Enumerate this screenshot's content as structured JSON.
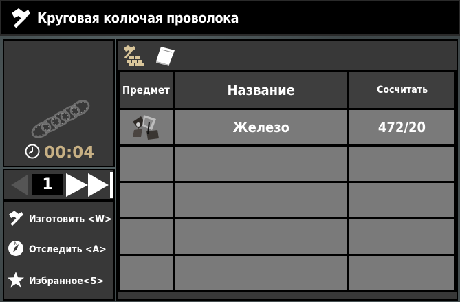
{
  "window": {
    "title": "Круговая колючая проволока",
    "title_icon": "hammer-icon"
  },
  "preview": {
    "item_icon": "barbed-wire-coil-icon",
    "craft_time": "00:04",
    "time_icon": "clock-icon"
  },
  "quantity": {
    "value": "1"
  },
  "actions": [
    {
      "label": "Изготовить <W>",
      "icon": "hammer-icon"
    },
    {
      "label": "Отследить <A>",
      "icon": "compass-icon"
    },
    {
      "label": "Избранное<S>",
      "icon": "star-icon"
    }
  ],
  "tabs": [
    {
      "icon": "crafting-station-icon"
    },
    {
      "icon": "recipe-book-icon"
    }
  ],
  "table": {
    "headers": [
      "Предмет",
      "Название",
      "Сосчитать"
    ],
    "rows": [
      {
        "icon": "iron-pieces-icon",
        "name": "Железо",
        "count": "472/20"
      },
      {
        "icon": "",
        "name": "",
        "count": ""
      },
      {
        "icon": "",
        "name": "",
        "count": ""
      },
      {
        "icon": "",
        "name": "",
        "count": ""
      },
      {
        "icon": "",
        "name": "",
        "count": ""
      }
    ]
  },
  "colors": {
    "title_bar": "#000000",
    "panel": "#383838",
    "cell": "#7a7a7a",
    "header_cell": "#3e3e3e",
    "time_text": "#c7b084",
    "icon_tan": "#d8c59a"
  }
}
